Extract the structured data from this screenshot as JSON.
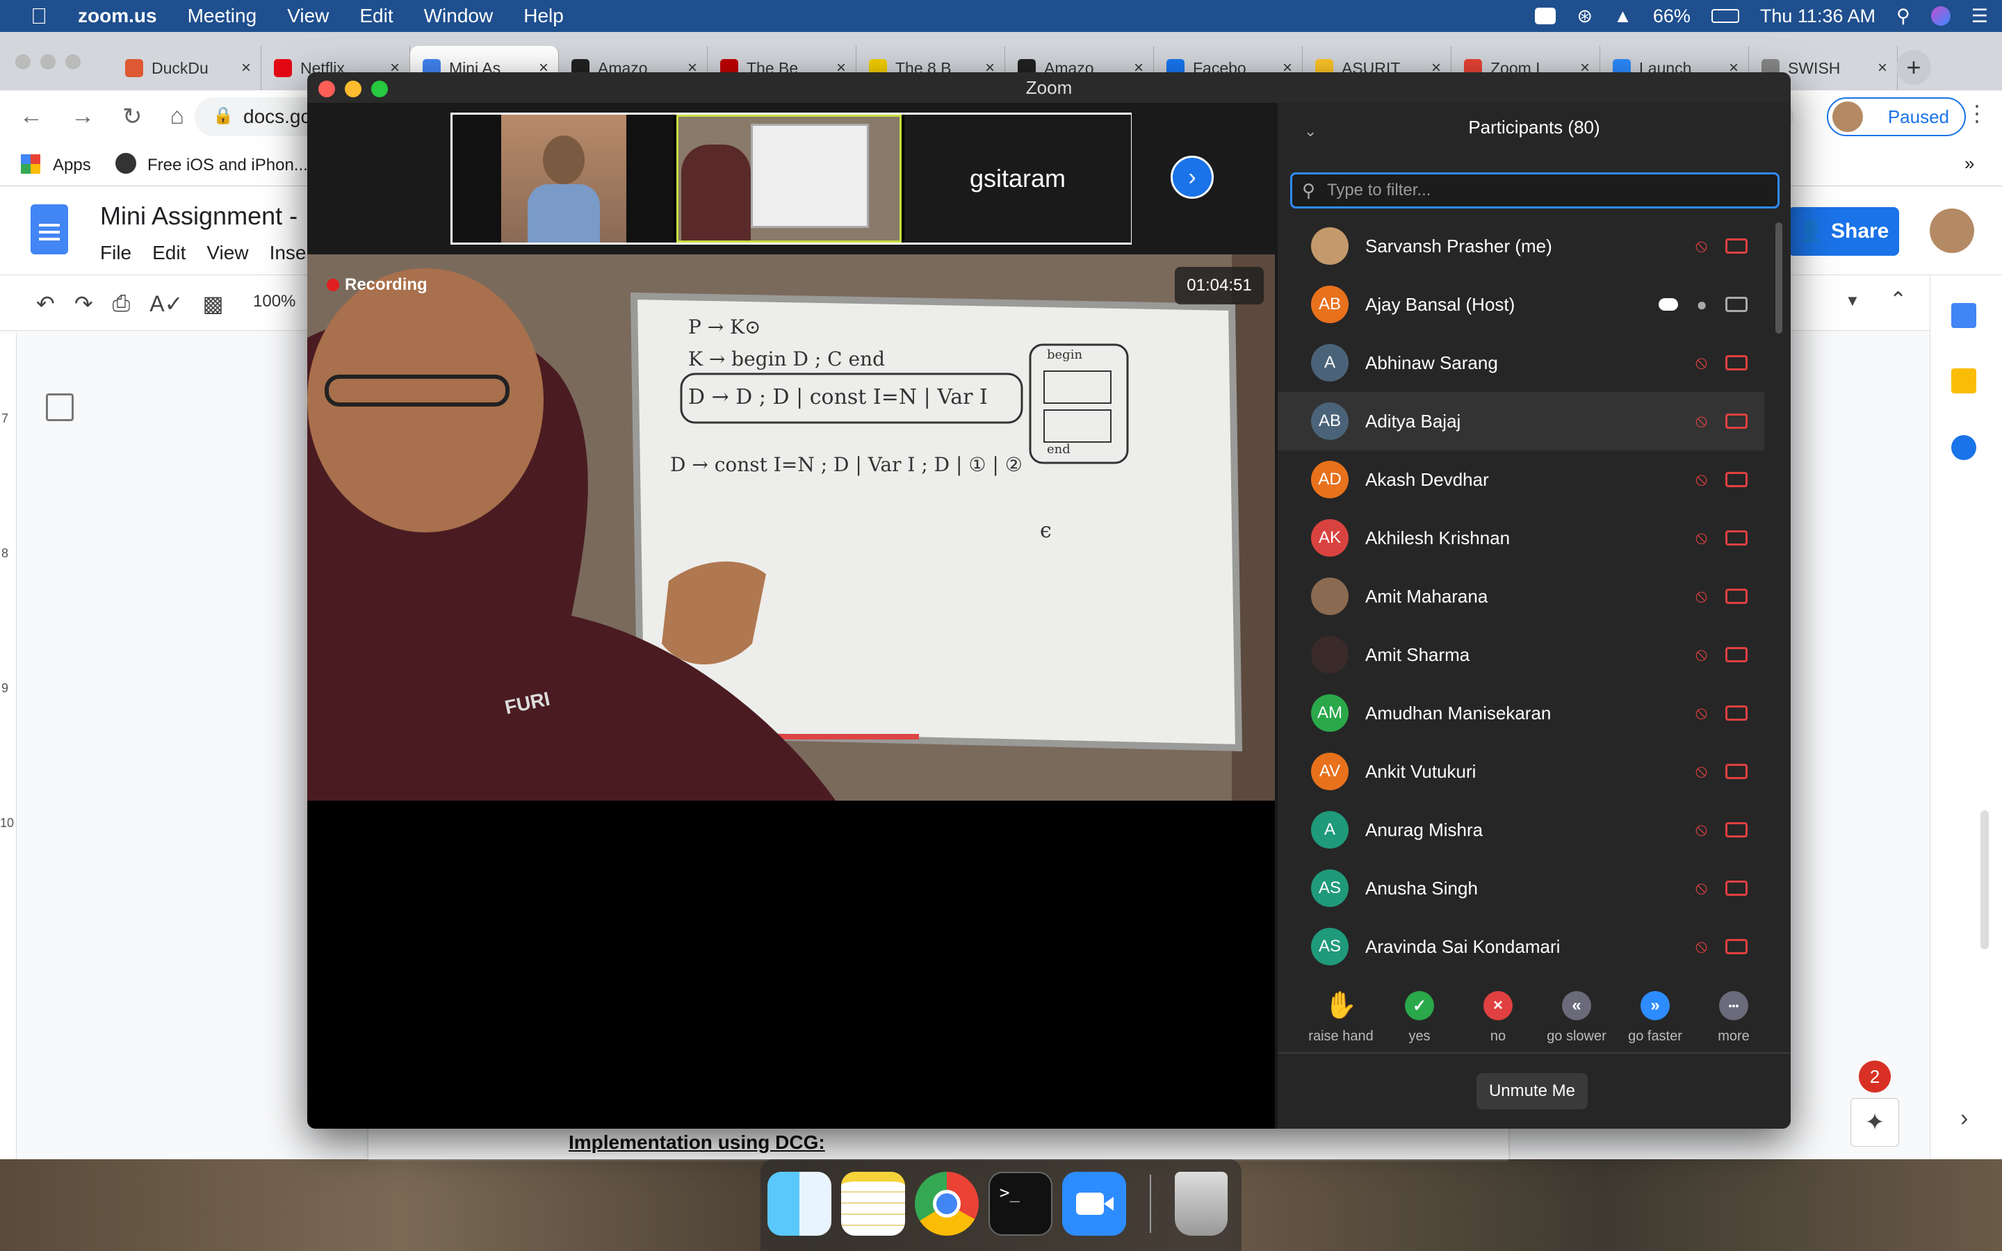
{
  "menubar": {
    "app_name": "zoom.us",
    "items": [
      "Meeting",
      "View",
      "Edit",
      "Window",
      "Help"
    ],
    "battery": "66%",
    "clock": "Thu 11:36 AM"
  },
  "browser": {
    "tabs": [
      {
        "label": "DuckDu",
        "icon": "duckduckgo-icon",
        "color": "#de5833"
      },
      {
        "label": "Netflix",
        "icon": "netflix-icon",
        "color": "#e50914"
      },
      {
        "label": "Mini As",
        "icon": "google-docs-icon",
        "color": "#4285f4"
      },
      {
        "label": "Amazo",
        "icon": "amazon-icon",
        "color": "#222222"
      },
      {
        "label": "The Be",
        "icon": "cnet-icon",
        "color": "#c00000"
      },
      {
        "label": "The 8 B",
        "icon": "lifehacker-icon",
        "color": "#f5d000"
      },
      {
        "label": "Amazo",
        "icon": "amazon-icon",
        "color": "#222222"
      },
      {
        "label": "Facebo",
        "icon": "facebook-icon",
        "color": "#1877f2"
      },
      {
        "label": "ASURIT",
        "icon": "asu-icon",
        "color": "#ffc627"
      },
      {
        "label": "Zoom I",
        "icon": "gmail-icon",
        "color": "#ea4335"
      },
      {
        "label": "Launch",
        "icon": "zoom-icon",
        "color": "#2d8cff"
      },
      {
        "label": "SWISH",
        "icon": "swish-icon",
        "color": "#888888"
      }
    ],
    "url": "docs.gc",
    "bookmarks": [
      "Apps",
      "Free iOS and iPhon..."
    ],
    "profile_status": "Paused"
  },
  "docs": {
    "title": "Mini Assignment -",
    "menus": [
      "File",
      "Edit",
      "View",
      "Inser"
    ],
    "zoom_level": "100%",
    "share_label": "Share",
    "body_heading": "Implementation using DCG:",
    "ruler_marks": [
      "7",
      "8",
      "9",
      "10"
    ],
    "notification_count": "2"
  },
  "zoom": {
    "window_title": "Zoom",
    "strip_name": "gsitaram",
    "recording_label": "Recording",
    "timer": "01:04:51",
    "whiteboard_lines": [
      "P → K⊙",
      "K → begin D ; C  end",
      "D → D ; D | const I=N | Var I",
      "D → const I=N ; D | Var I ; D | ① | ②",
      "ϵ"
    ],
    "whiteboard_box": [
      "begin",
      "end"
    ],
    "shirt_text": "FURI",
    "participants_title": "Participants (80)",
    "search_placeholder": "Type to filter...",
    "participants": [
      {
        "name": "Sarvansh Prasher (me)",
        "initials": "",
        "color": "#c49a6c"
      },
      {
        "name": "Ajay Bansal (Host)",
        "initials": "AB",
        "color": "#e8711c"
      },
      {
        "name": "Abhinaw Sarang",
        "initials": "A",
        "color": "#4a6378"
      },
      {
        "name": "Aditya Bajaj",
        "initials": "AB",
        "color": "#4a6378"
      },
      {
        "name": "Akash Devdhar",
        "initials": "AD",
        "color": "#e8711c"
      },
      {
        "name": "Akhilesh Krishnan",
        "initials": "AK",
        "color": "#d9433f"
      },
      {
        "name": "Amit Maharana",
        "initials": "",
        "color": "#8a6a50"
      },
      {
        "name": "Amit Sharma",
        "initials": "",
        "color": "#3a2a2a"
      },
      {
        "name": "Amudhan Manisekaran",
        "initials": "AM",
        "color": "#2aa84a"
      },
      {
        "name": "Ankit Vutukuri",
        "initials": "AV",
        "color": "#e8711c"
      },
      {
        "name": "Anurag Mishra",
        "initials": "A",
        "color": "#1f9a7a"
      },
      {
        "name": "Anusha Singh",
        "initials": "AS",
        "color": "#1f9a7a"
      },
      {
        "name": "Aravinda Sai Kondamari",
        "initials": "AS",
        "color": "#1f9a7a"
      }
    ],
    "reactions": [
      {
        "label": "raise hand",
        "icon": "hand-icon",
        "color": "#2d8cff"
      },
      {
        "label": "yes",
        "icon": "check-icon",
        "color": "#2aa84a"
      },
      {
        "label": "no",
        "icon": "x-icon",
        "color": "#e04040"
      },
      {
        "label": "go slower",
        "icon": "rewind-icon",
        "color": "#6a6a7a"
      },
      {
        "label": "go faster",
        "icon": "fast-forward-icon",
        "color": "#2d8cff"
      },
      {
        "label": "more",
        "icon": "more-icon",
        "color": "#6a6a7a"
      }
    ],
    "unmute_label": "Unmute Me"
  }
}
